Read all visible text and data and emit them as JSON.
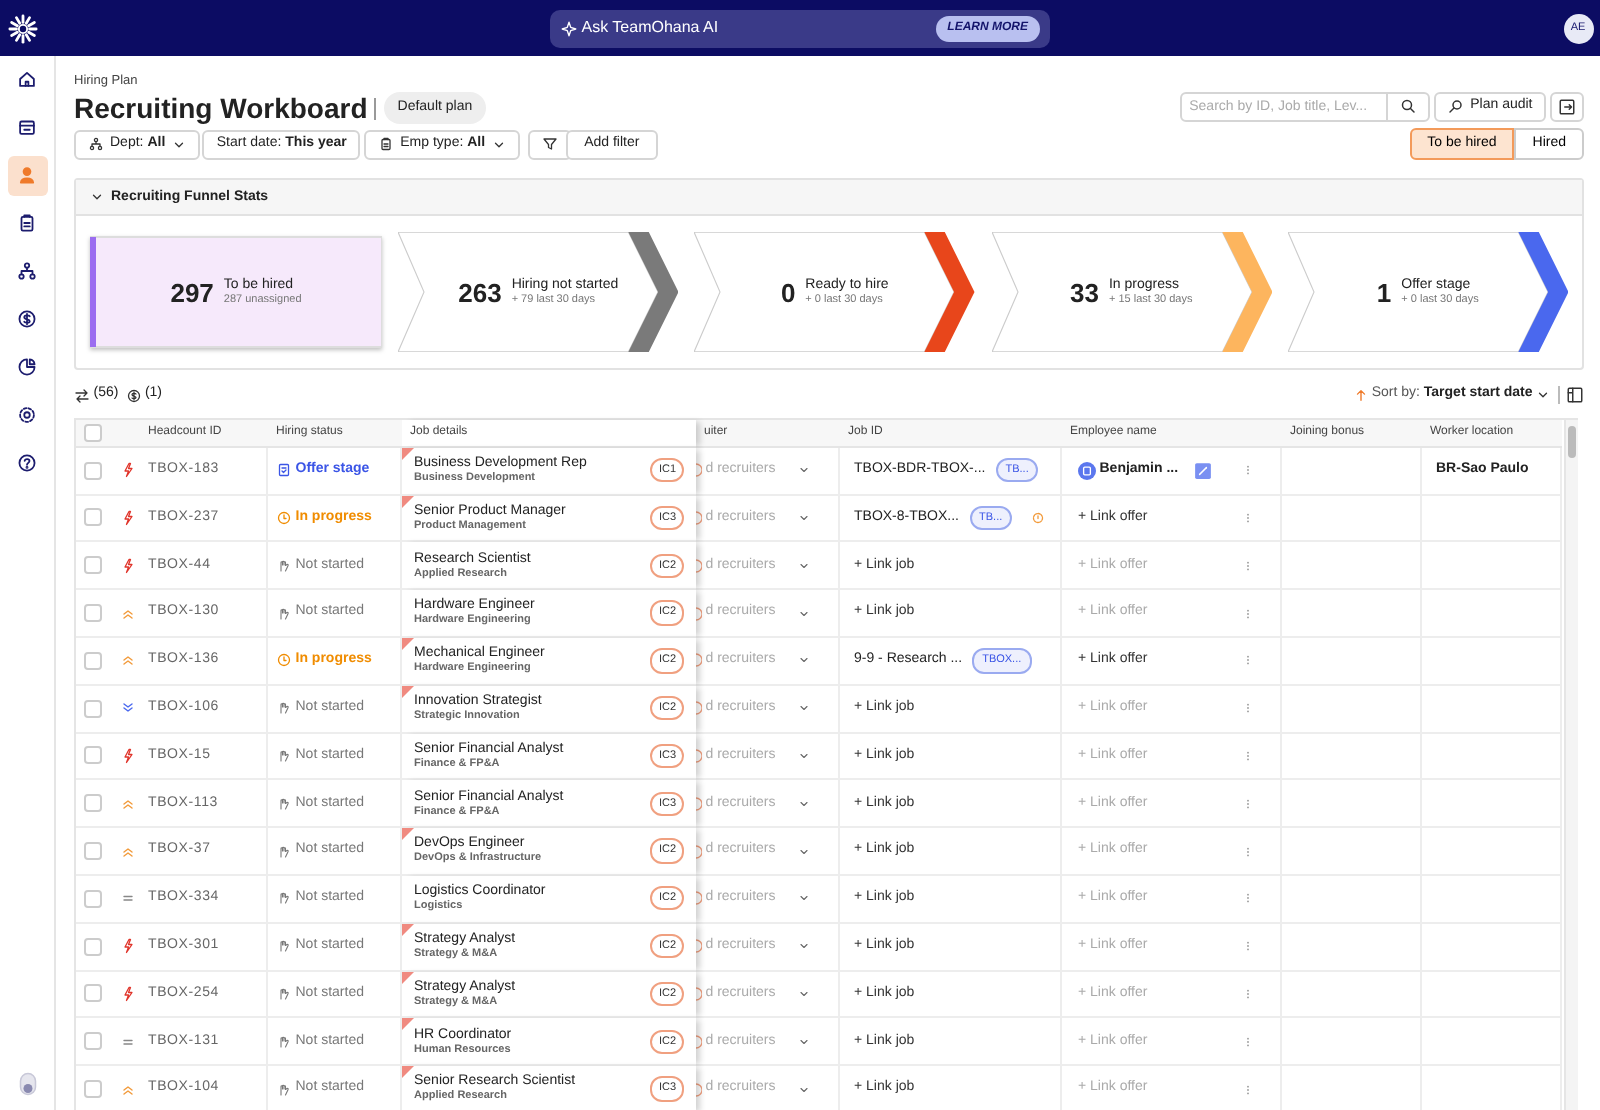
{
  "topbar": {
    "ai_prompt": "Ask TeamOhana AI",
    "ai_button": "LEARN MORE",
    "avatar": "AE"
  },
  "sidebar": {
    "items": [
      {
        "kind": "home",
        "selected": false
      },
      {
        "kind": "calendar",
        "selected": false
      },
      {
        "kind": "person",
        "selected": true
      },
      {
        "kind": "clipboard",
        "selected": false
      },
      {
        "kind": "org",
        "selected": false
      },
      {
        "kind": "dollar",
        "selected": false
      },
      {
        "kind": "pie",
        "selected": false
      },
      {
        "kind": "gear",
        "selected": false
      },
      {
        "kind": "help",
        "selected": false
      }
    ]
  },
  "header": {
    "breadcrumb": "Hiring Plan",
    "title": "Recruiting Workboard",
    "plan": "Default plan",
    "search": {
      "placeholder": "Search by ID, Job title, Lev..."
    },
    "audit_button": "Plan audit"
  },
  "filters": [
    {
      "kind": "org",
      "label": "Dept:",
      "value": "All"
    },
    {
      "kind": "plain",
      "label": "Start date:",
      "value": "This year"
    },
    {
      "kind": "doc",
      "label": "Emp type:",
      "value": "All"
    }
  ],
  "add_filter": "Add filter",
  "view_toggle": [
    {
      "label": "To be hired",
      "selected": true
    },
    {
      "label": "Hired",
      "selected": false
    }
  ],
  "funnel": {
    "title": "Recruiting Funnel Stats",
    "expanded": true,
    "stages": [
      {
        "count": "297",
        "label": "To be hired",
        "sub": "287 unassigned",
        "color": "#9b6cf0",
        "selected": true
      },
      {
        "count": "263",
        "label": "Hiring not started",
        "sub": "+ 79 last 30 days",
        "color": "#7a7a7a",
        "selected": false
      },
      {
        "count": "0",
        "label": "Ready to hire",
        "sub": "+ 0 last 30 days",
        "color": "#e8461b",
        "selected": false
      },
      {
        "count": "33",
        "label": "In progress",
        "sub": "+ 15 last 30 days",
        "color": "#fdb55e",
        "selected": false
      },
      {
        "count": "1",
        "label": "Offer stage",
        "sub": "+ 0 last 30 days",
        "color": "#4a68ee",
        "selected": false
      }
    ]
  },
  "table_toolbar": {
    "requisitions": "(56)",
    "offers": "(1)",
    "sort_label": "Sort by:",
    "sort_value": "Target start date"
  },
  "table": {
    "select_all": {
      "checked": false
    },
    "columns": [
      "Headcount ID",
      "Hiring status",
      "Job details",
      "uiter",
      "Job ID",
      "Employee name",
      "Joining bonus",
      "Worker location"
    ],
    "rows": [
      {
        "checked": false,
        "priority": {
          "kind": "urgent"
        },
        "id": "TBOX-183",
        "status": {
          "kind": "offer",
          "text": "Offer stage"
        },
        "job_title": "Business Development Rep",
        "department": "Business Development",
        "level": "IC1",
        "flagged": true,
        "recruiter": "d recruiters",
        "job": {
          "kind": "linked",
          "text": "TBOX-BDR-TBOX-...",
          "tag": "TB...",
          "warning": false
        },
        "employee": {
          "kind": "person",
          "text": "Benjamin ..."
        },
        "location": "BR-Sao Paulo"
      },
      {
        "checked": false,
        "priority": {
          "kind": "urgent"
        },
        "id": "TBOX-237",
        "status": {
          "kind": "progress",
          "text": "In progress"
        },
        "job_title": "Senior Product Manager",
        "department": "Product Management",
        "level": "IC3",
        "flagged": true,
        "recruiter": "d recruiters",
        "job": {
          "kind": "linked",
          "text": "TBOX-8-TBOX...",
          "tag": "TB...",
          "warning": true
        },
        "employee": {
          "kind": "link",
          "text": "+ Link offer",
          "disabled": false
        }
      },
      {
        "checked": false,
        "priority": {
          "kind": "urgent"
        },
        "id": "TBOX-44",
        "status": {
          "kind": "not_started",
          "text": "Not started"
        },
        "job_title": "Research Scientist",
        "department": "Applied Research",
        "level": "IC2",
        "flagged": false,
        "recruiter": "d recruiters",
        "job": {
          "kind": "link",
          "text": "+ Link job"
        },
        "employee": {
          "kind": "link",
          "text": "+ Link offer",
          "disabled": true
        }
      },
      {
        "checked": false,
        "priority": {
          "kind": "high"
        },
        "id": "TBOX-130",
        "status": {
          "kind": "not_started",
          "text": "Not started"
        },
        "job_title": "Hardware Engineer",
        "department": "Hardware Engineering",
        "level": "IC2",
        "flagged": false,
        "recruiter": "d recruiters",
        "job": {
          "kind": "link",
          "text": "+ Link job"
        },
        "employee": {
          "kind": "link",
          "text": "+ Link offer",
          "disabled": true
        }
      },
      {
        "checked": false,
        "priority": {
          "kind": "high"
        },
        "id": "TBOX-136",
        "status": {
          "kind": "progress",
          "text": "In progress"
        },
        "job_title": "Mechanical Engineer",
        "department": "Hardware Engineering",
        "level": "IC2",
        "flagged": true,
        "recruiter": "d recruiters",
        "job": {
          "kind": "linked",
          "text": "9-9 - Research ...",
          "tag": "TBOX...",
          "warning": false
        },
        "employee": {
          "kind": "link",
          "text": "+ Link offer",
          "disabled": false
        }
      },
      {
        "checked": false,
        "priority": {
          "kind": "low"
        },
        "id": "TBOX-106",
        "status": {
          "kind": "not_started",
          "text": "Not started"
        },
        "job_title": "Innovation Strategist",
        "department": "Strategic Innovation",
        "level": "IC2",
        "flagged": true,
        "recruiter": "d recruiters",
        "job": {
          "kind": "link",
          "text": "+ Link job"
        },
        "employee": {
          "kind": "link",
          "text": "+ Link offer",
          "disabled": true
        }
      },
      {
        "checked": false,
        "priority": {
          "kind": "urgent"
        },
        "id": "TBOX-15",
        "status": {
          "kind": "not_started",
          "text": "Not started"
        },
        "job_title": "Senior Financial Analyst",
        "department": "Finance & FP&A",
        "level": "IC3",
        "flagged": false,
        "recruiter": "d recruiters",
        "job": {
          "kind": "link",
          "text": "+ Link job"
        },
        "employee": {
          "kind": "link",
          "text": "+ Link offer",
          "disabled": true
        }
      },
      {
        "checked": false,
        "priority": {
          "kind": "high"
        },
        "id": "TBOX-113",
        "status": {
          "kind": "not_started",
          "text": "Not started"
        },
        "job_title": "Senior Financial Analyst",
        "department": "Finance & FP&A",
        "level": "IC3",
        "flagged": false,
        "recruiter": "d recruiters",
        "job": {
          "kind": "link",
          "text": "+ Link job"
        },
        "employee": {
          "kind": "link",
          "text": "+ Link offer",
          "disabled": true
        }
      },
      {
        "checked": false,
        "priority": {
          "kind": "high"
        },
        "id": "TBOX-37",
        "status": {
          "kind": "not_started",
          "text": "Not started"
        },
        "job_title": "DevOps Engineer",
        "department": "DevOps & Infrastructure",
        "level": "IC2",
        "flagged": true,
        "recruiter": "d recruiters",
        "job": {
          "kind": "link",
          "text": "+ Link job"
        },
        "employee": {
          "kind": "link",
          "text": "+ Link offer",
          "disabled": true
        }
      },
      {
        "checked": false,
        "priority": {
          "kind": "medium"
        },
        "id": "TBOX-334",
        "status": {
          "kind": "not_started",
          "text": "Not started"
        },
        "job_title": "Logistics Coordinator",
        "department": "Logistics",
        "level": "IC2",
        "flagged": false,
        "recruiter": "d recruiters",
        "job": {
          "kind": "link",
          "text": "+ Link job"
        },
        "employee": {
          "kind": "link",
          "text": "+ Link offer",
          "disabled": true
        }
      },
      {
        "checked": false,
        "priority": {
          "kind": "urgent"
        },
        "id": "TBOX-301",
        "status": {
          "kind": "not_started",
          "text": "Not started"
        },
        "job_title": "Strategy Analyst",
        "department": "Strategy & M&A",
        "level": "IC2",
        "flagged": true,
        "recruiter": "d recruiters",
        "job": {
          "kind": "link",
          "text": "+ Link job"
        },
        "employee": {
          "kind": "link",
          "text": "+ Link offer",
          "disabled": true
        }
      },
      {
        "checked": false,
        "priority": {
          "kind": "urgent"
        },
        "id": "TBOX-254",
        "status": {
          "kind": "not_started",
          "text": "Not started"
        },
        "job_title": "Strategy Analyst",
        "department": "Strategy & M&A",
        "level": "IC2",
        "flagged": true,
        "recruiter": "d recruiters",
        "job": {
          "kind": "link",
          "text": "+ Link job"
        },
        "employee": {
          "kind": "link",
          "text": "+ Link offer",
          "disabled": true
        }
      },
      {
        "checked": false,
        "priority": {
          "kind": "medium"
        },
        "id": "TBOX-131",
        "status": {
          "kind": "not_started",
          "text": "Not started"
        },
        "job_title": "HR Coordinator",
        "department": "Human Resources",
        "level": "IC2",
        "flagged": true,
        "recruiter": "d recruiters",
        "job": {
          "kind": "link",
          "text": "+ Link job"
        },
        "employee": {
          "kind": "link",
          "text": "+ Link offer",
          "disabled": true
        }
      },
      {
        "checked": false,
        "priority": {
          "kind": "high"
        },
        "id": "TBOX-104",
        "status": {
          "kind": "not_started",
          "text": "Not started"
        },
        "job_title": "Senior Research Scientist",
        "department": "Applied Research",
        "level": "IC3",
        "flagged": true,
        "recruiter": "d recruiters",
        "job": {
          "kind": "link",
          "text": "+ Link job"
        },
        "employee": {
          "kind": "link",
          "text": "+ Link offer",
          "disabled": true
        }
      }
    ]
  }
}
